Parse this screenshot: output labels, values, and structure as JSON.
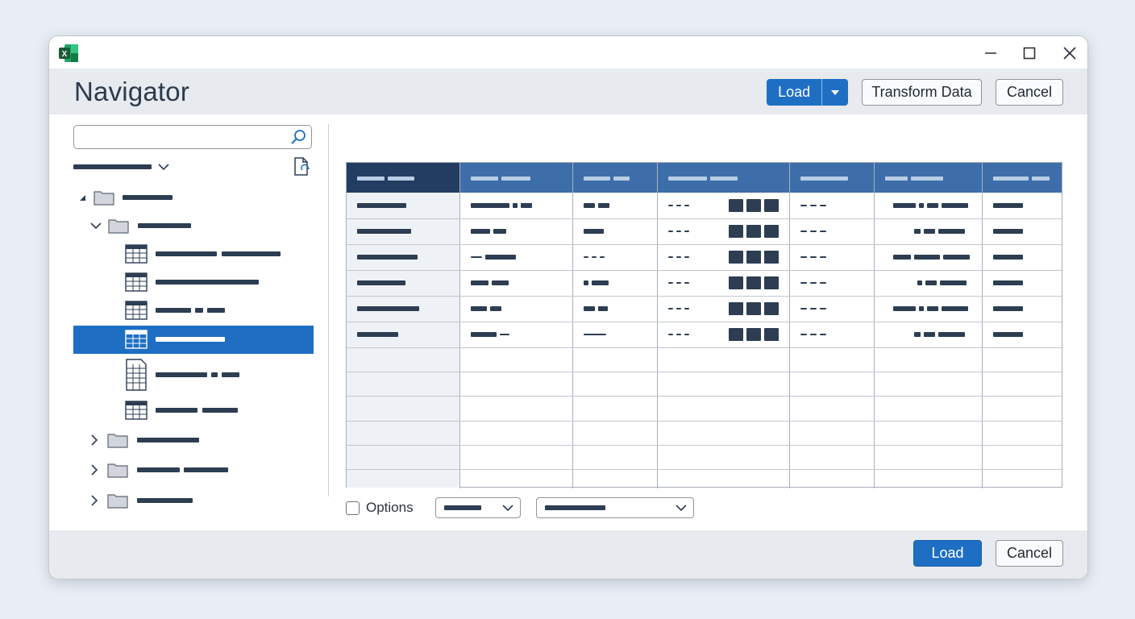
{
  "app": {
    "icon": "excel-icon",
    "accent": "#1e6fc4",
    "header_color": "#3d6eaa"
  },
  "window": {
    "minimize_icon": "minimize-icon",
    "maximize_icon": "maximize-icon",
    "close_icon": "close-icon"
  },
  "header": {
    "title": "Navigator",
    "load_label": "Load",
    "transform_label": "Transform Data",
    "cancel_label": "Cancel"
  },
  "navigator": {
    "search": {
      "value": "",
      "placeholder": ""
    }
  },
  "preview": {
    "options_label": "Options"
  },
  "footer": {
    "load_label": "Load",
    "cancel_label": "Cancel"
  }
}
